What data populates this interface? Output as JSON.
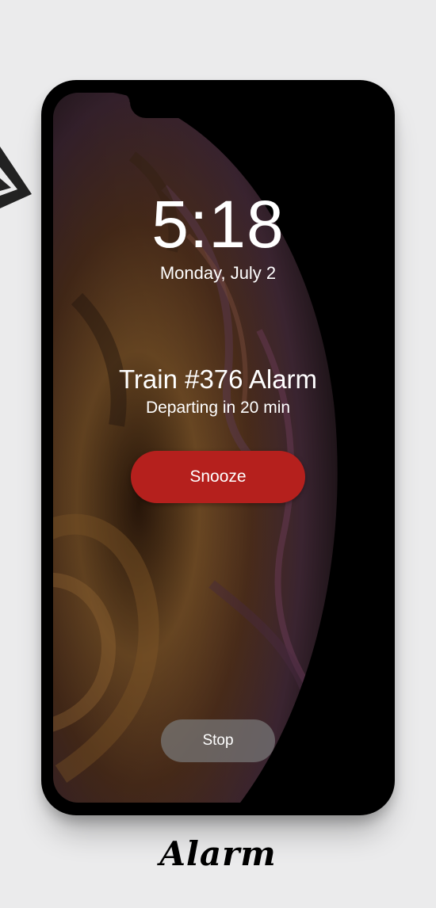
{
  "lock_screen": {
    "time": "5:18",
    "date": "Monday, July 2"
  },
  "alarm": {
    "title": "Train #376 Alarm",
    "subtitle": "Departing in 20 min",
    "snooze_label": "Snooze",
    "stop_label": "Stop"
  },
  "caption": "Alarm",
  "icons": {
    "corner": "paper-plane-icon"
  },
  "colors": {
    "page_background": "#ebebec",
    "phone_frame": "#000000",
    "snooze_button": "#b5201d",
    "stop_button": "#787878",
    "text": "#ffffff"
  }
}
